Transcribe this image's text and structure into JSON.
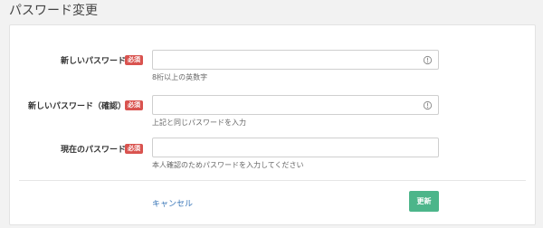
{
  "page": {
    "title": "パスワード変更"
  },
  "form": {
    "required_badge": "必須",
    "fields": [
      {
        "label": "新しいパスワード",
        "value": "",
        "help": "8桁以上の英数字",
        "icon": "eye-icon"
      },
      {
        "label": "新しいパスワード（確認）",
        "value": "",
        "help": "上記と同じパスワードを入力",
        "icon": "eye-icon"
      },
      {
        "label": "現在のパスワード",
        "value": "",
        "help": "本人確認のためパスワードを入力してください",
        "icon": ""
      }
    ]
  },
  "actions": {
    "cancel_label": "キャンセル",
    "update_label": "更新"
  },
  "colors": {
    "required": "#d9534f",
    "primary": "#4cb58a",
    "link": "#3a77b8"
  }
}
